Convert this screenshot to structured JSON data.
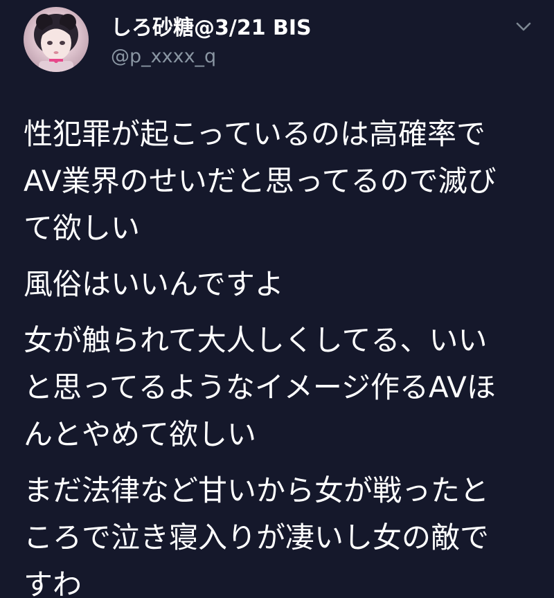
{
  "tweet": {
    "author": {
      "display_name": "しろ砂糖@3/21 BIS",
      "handle": "@p_xxxx_q"
    },
    "menu_icon": "chevron-down-icon",
    "paragraphs": [
      {
        "lines": [
          "性犯罪が起こっているのは高確率で",
          "AV業界のせいだと思ってるので滅び",
          "て欲しい"
        ]
      },
      {
        "lines": [
          "風俗はいいんですよ"
        ]
      },
      {
        "lines": [
          "女が触られて大人しくしてる、いい",
          "と思ってるようなイメージ作るAVほ",
          "んとやめて欲しい"
        ]
      },
      {
        "lines": [
          "まだ法律など甘いから女が戦ったと",
          "ころで泣き寝入りが凄いし女の敵で",
          "すわ"
        ]
      }
    ]
  },
  "colors": {
    "background": "#15182b",
    "primary_text": "#ffffff",
    "secondary_text": "#8a96a3"
  }
}
